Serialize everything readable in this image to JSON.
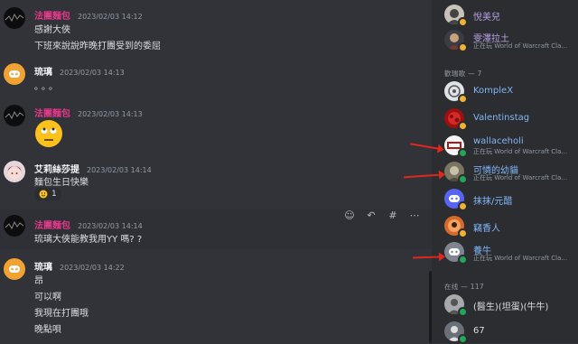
{
  "messages": [
    {
      "user": "法團麵包",
      "time": "2023/02/03 14:12",
      "color": "#e5398b",
      "lines": [
        "感謝大俠",
        "下班來說說昨晚打團受到的委屈"
      ]
    },
    {
      "user": "琉璃",
      "time": "2023/02/03 14:13",
      "color": "#f2f3f5",
      "lines": [
        "。。。"
      ]
    },
    {
      "user": "法團麵包",
      "time": "2023/02/03 14:13",
      "color": "#e5398b",
      "emoji": "rolling-eyes"
    },
    {
      "user": "艾莉絲莎提",
      "time": "2023/02/03 14:14",
      "color": "#f2f3f5",
      "lines": [
        "麵包生日快樂"
      ],
      "reaction": {
        "emoji": "grinning-face",
        "count": "1"
      }
    },
    {
      "user": "法團麵包",
      "time": "2023/02/03 14:14",
      "color": "#e5398b",
      "lines": [
        "琉璃大俠能教我用YY 嗎? ?"
      ]
    },
    {
      "user": "琉璃",
      "time": "2023/02/03 14:22",
      "color": "#f2f3f5",
      "lines": [
        "昂",
        "可以啊",
        "我現在打團哦",
        "晚點唄"
      ]
    }
  ],
  "toolbar_icons": [
    "add-reaction-icon",
    "reply-icon",
    "hashtag-thread-icon",
    "more-icon"
  ],
  "members_top": [
    {
      "name": "悅美兒",
      "color": "#b9a3e8",
      "status": "idle"
    },
    {
      "name": "雯澤拉土",
      "color": "#b9a3e8",
      "activity": "正在玩 World of Warcraft Cla...",
      "status": "idle"
    }
  ],
  "category_1": "歡瑞歌 — 7",
  "members_cat1": [
    {
      "name": "KompleX",
      "color": "#82b6f7",
      "status": "idle"
    },
    {
      "name": "Valentinstag",
      "color": "#82b6f7",
      "status": "idle"
    },
    {
      "name": "wallaceholi",
      "color": "#82b6f7",
      "activity": "正在玩 World of Warcraft Cla...",
      "status": "online"
    },
    {
      "name": "可憐的幼貓",
      "color": "#82b6f7",
      "activity": "正在玩 World of Warcraft Cla...",
      "status": "online"
    },
    {
      "name": "抹抹/元醋",
      "color": "#82b6f7",
      "status": "idle"
    },
    {
      "name": "竊香人",
      "color": "#82b6f7",
      "status": "idle"
    },
    {
      "name": "養牛",
      "color": "#82b6f7",
      "activity": "正在玩 World of Warcraft Cla...",
      "status": "online"
    }
  ],
  "category_2": "在线 — 117",
  "members_cat2": [
    {
      "name": "(醫生)(坦蛋)(牛牛)",
      "color": "#dbdee1",
      "status": "online"
    },
    {
      "name": "67",
      "color": "#dbdee1",
      "status": "online"
    }
  ],
  "colors": {
    "accent_arrow": "#e0271d",
    "online": "#23a55a",
    "idle": "#f0b232",
    "discord": "#f0a232",
    "background": "#313338"
  }
}
